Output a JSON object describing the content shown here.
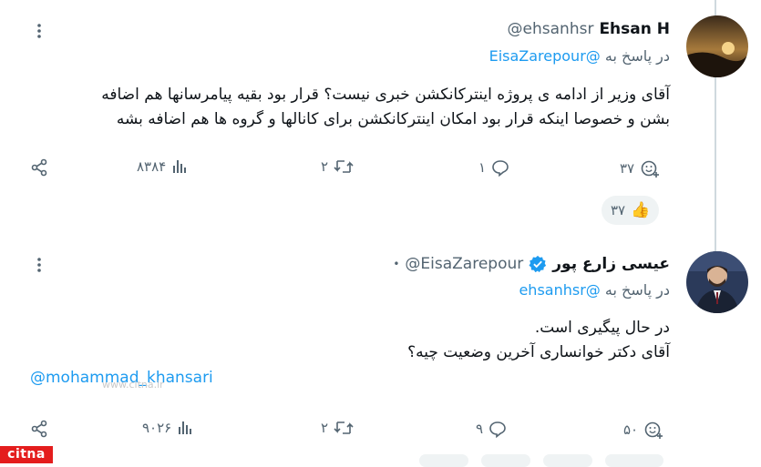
{
  "tweet1": {
    "display_name": "Ehsan H",
    "handle": "@ehsanhsr",
    "reply_prefix": "در پاسخ به",
    "reply_to": "@EisaZarepour",
    "lines": [
      "آقای وزیر از ادامه ی پروژه اینترکانکشن خبری نیست؟ قرار بود بقیه پیامرسانها هم اضافه",
      "بشن و خصوصا اینکه قرار بود امکان اینترکانکشن برای کانالها و گروه ها هم اضافه بشه"
    ],
    "actions": {
      "views": "۸۳۸۴",
      "retweets": "۲",
      "replies": "۱",
      "likes": "۳۷"
    },
    "reaction": {
      "emoji": "👍",
      "count": "۳۷"
    }
  },
  "tweet2": {
    "display_name": "عیسی زارع پور",
    "handle": "@EisaZarepour",
    "separator": "•",
    "reply_prefix": "در پاسخ به",
    "reply_to": "@ehsanhsr",
    "lines": [
      "در حال پیگیری است.",
      "آقای دکتر خوانساری آخرین وضعیت چیه؟"
    ],
    "mention": "@mohammad_khansari",
    "watermark": "www.citna.ir",
    "actions": {
      "views": "۹۰۲۶",
      "retweets": "۲",
      "replies": "۹",
      "likes": "۵۰"
    }
  },
  "logo": "citna",
  "colors": {
    "accent": "#1d9bf0",
    "muted": "#536471",
    "text": "#0f1419",
    "verified": "#1d9bf0",
    "logo": "#e41d1d"
  }
}
